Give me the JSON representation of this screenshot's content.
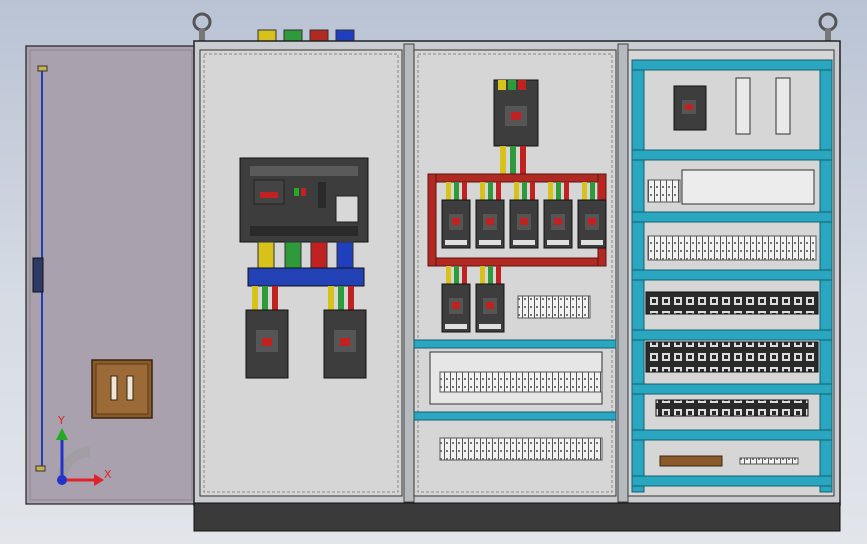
{
  "scene": {
    "background_top": "#b9c3d4",
    "background_bottom": "#e2e5ea"
  },
  "triad": {
    "x_label": "X",
    "y_label": "Y",
    "x_color": "#e0242a",
    "y_color": "#22aa22",
    "z_color": "#2233cc"
  },
  "colors": {
    "cabinet_frame": "#c9ccd1",
    "mounting_plate": "#d6d6d6",
    "door": "#a9a1ad",
    "plinth": "#3a3a3a",
    "busbar_blue": "#2141b5",
    "busbar_red": "#b12a22",
    "wire_yellow": "#d6c21a",
    "wire_green": "#2f9a3a",
    "wire_red": "#c02222",
    "wire_blue": "#1f3fbf",
    "din_rail_teal": "#2aa6c0",
    "breaker_body": "#3d3d3d",
    "handle_brown": "#8a5a2a"
  },
  "icons": [
    "lifting-eye-icon",
    "handle-icon",
    "axis-triad-icon"
  ]
}
